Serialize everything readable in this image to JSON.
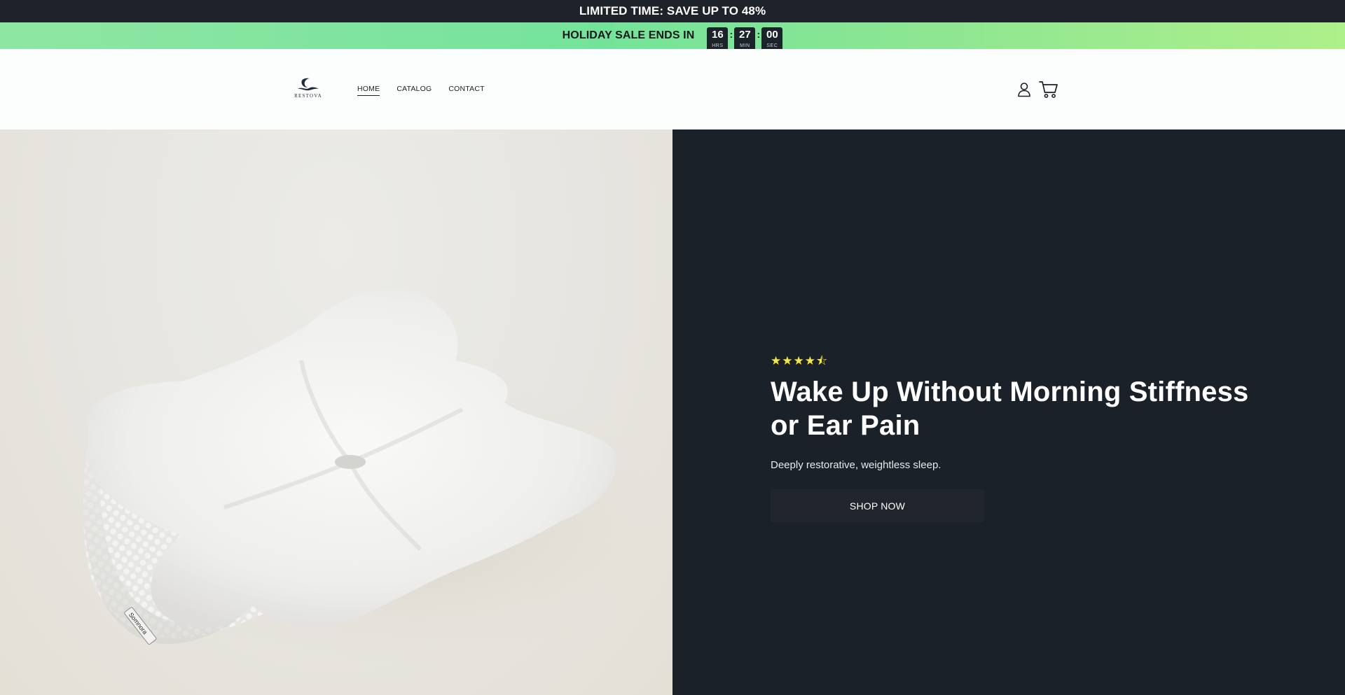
{
  "announcement": {
    "text": "LIMITED TIME: SAVE UP TO 48%"
  },
  "sale_bar": {
    "text": "HOLIDAY SALE ENDS IN",
    "timer": [
      {
        "value": "16",
        "label": "HRS"
      },
      {
        "value": "27",
        "label": "MIN"
      },
      {
        "value": "00",
        "label": "SEC"
      }
    ],
    "separator": ":"
  },
  "header": {
    "logo_text": "RESTOVA",
    "nav": [
      {
        "label": "HOME",
        "active": true
      },
      {
        "label": "CATALOG",
        "active": false
      },
      {
        "label": "CONTACT",
        "active": false
      }
    ],
    "icons": [
      "account-icon",
      "cart-icon"
    ]
  },
  "hero": {
    "image": {
      "subject": "white cervical pillow",
      "tag_text": "Somnora"
    },
    "rating": {
      "stars": 4.5,
      "max": 5,
      "display": "★★★★⯪"
    },
    "headline": "Wake Up Without Morning Stiffness or Ear Pain",
    "subtext": "Deeply restorative, weightless sleep.",
    "cta_label": "SHOP NOW"
  },
  "colors": {
    "announcement_bg": "#1e232b",
    "sale_bar_green": "#74e39a",
    "hero_panel_bg": "#1b2129",
    "star_color": "#f5e93b",
    "button_bg": "#21252d"
  }
}
